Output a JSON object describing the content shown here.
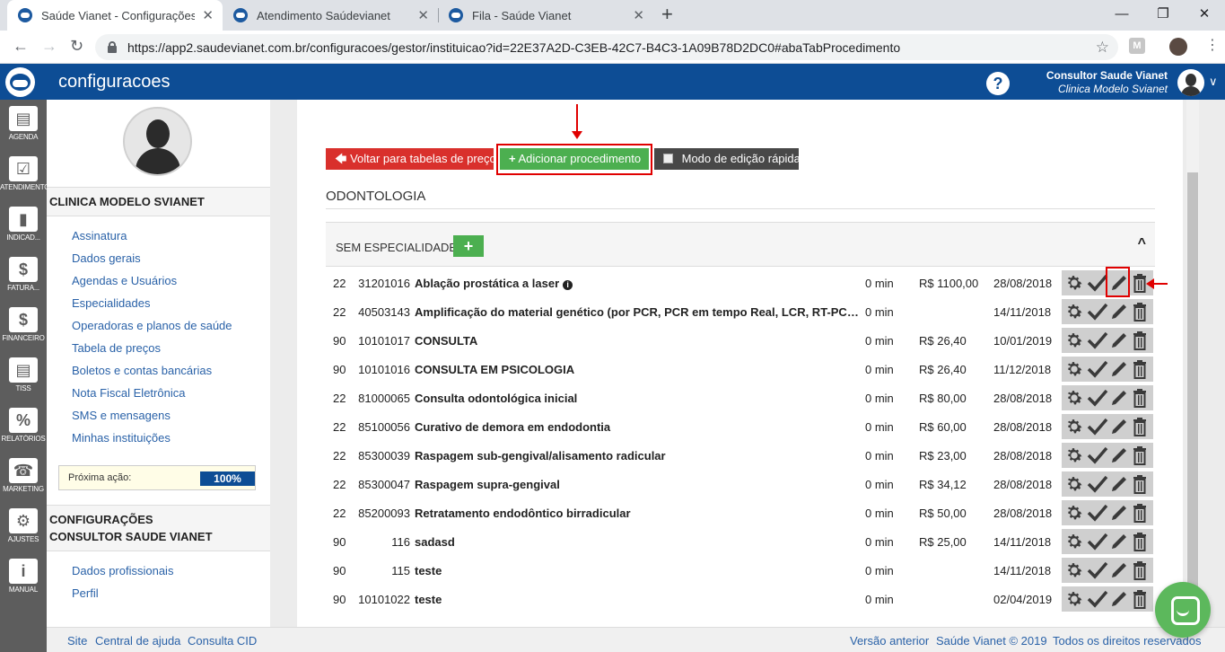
{
  "browser": {
    "tabs": [
      {
        "label": "Saúde Vianet - Configurações",
        "active": true
      },
      {
        "label": "Atendimento Saúdevianet",
        "active": false
      },
      {
        "label": "Fila - Saúde Vianet",
        "active": false
      }
    ],
    "url": "https://app2.saudevianet.com.br/configuracoes/gestor/instituicao?id=22E37A2D-C3EB-42C7-B4C3-1A09B78D2DC0#abaTabProcedimento",
    "new_tab": "+",
    "close_glyph": "✕",
    "win": {
      "minimize": "—",
      "maximize": "❐",
      "close": "✕"
    },
    "ext_letter": "M"
  },
  "header": {
    "title": "configuracoes",
    "help": "?",
    "user_name": "Consultor Saude Vianet",
    "user_clinic": "Clinica Modelo Svianet",
    "brand_color": "#0d4d95"
  },
  "rail": [
    {
      "label": "AGENDA",
      "icon": "agenda-icon",
      "glyph": "▤"
    },
    {
      "label": "ATENDIMENTO",
      "icon": "folder-check-icon",
      "glyph": "☑"
    },
    {
      "label": "INDICAD...",
      "icon": "bar-chart-icon",
      "glyph": "▮"
    },
    {
      "label": "FATURA...",
      "icon": "dollar-doc-icon",
      "glyph": "$"
    },
    {
      "label": "FINANCEIRO",
      "icon": "dollar-doc-icon",
      "glyph": "$"
    },
    {
      "label": "TISS",
      "icon": "book-icon",
      "glyph": "▤"
    },
    {
      "label": "RELATÓRIOS",
      "icon": "percent-doc-icon",
      "glyph": "%"
    },
    {
      "label": "MARKETING",
      "icon": "phone-icon",
      "glyph": "☎"
    },
    {
      "label": "AJUSTES",
      "icon": "gears-icon",
      "glyph": "⚙"
    },
    {
      "label": "MANUAL",
      "icon": "manual-icon",
      "glyph": "i"
    }
  ],
  "sidebar": {
    "clinic_title": "CLINICA MODELO SVIANET",
    "links": [
      "Assinatura",
      "Dados gerais",
      "Agendas e Usuários",
      "Especialidades",
      "Operadoras e planos de saúde",
      "Tabela de preços",
      "Boletos e contas bancárias",
      "Nota Fiscal Eletrônica",
      "SMS e mensagens",
      "Minhas instituições"
    ],
    "next_action_label": "Próxima ação:",
    "progress_percent": 100,
    "progress_text": "100%",
    "config_title_1": "CONFIGURAÇÕES",
    "config_title_2": "CONSULTOR SAUDE VIANET",
    "config_links": [
      "Dados profissionais",
      "Perfil"
    ]
  },
  "toolbar": {
    "back_label": "Voltar para tabelas de preços",
    "add_label": "Adicionar procedimento",
    "quick_edit_label": "Modo de edição rápida"
  },
  "section": {
    "title": "ODONTOLOGIA",
    "group_title": "SEM ESPECIALIDADE",
    "group_add": "+",
    "group_chevron": "^"
  },
  "procedures": [
    {
      "tab": "22",
      "code": "31201016",
      "name": "Ablação prostática a laser",
      "info": true,
      "time": "0 min",
      "price": "R$ 1100,00",
      "date": "28/08/2018"
    },
    {
      "tab": "22",
      "code": "40503143",
      "name": "Amplificação do material genético (por PCR, PCR em tempo Real, LCR, RT-PCR...",
      "info": false,
      "time": "0 min",
      "price": "",
      "date": "14/11/2018"
    },
    {
      "tab": "90",
      "code": "10101017",
      "name": "CONSULTA",
      "info": false,
      "time": "0 min",
      "price": "R$ 26,40",
      "date": "10/01/2019"
    },
    {
      "tab": "90",
      "code": "10101016",
      "name": "CONSULTA EM PSICOLOGIA",
      "info": false,
      "time": "0 min",
      "price": "R$ 26,40",
      "date": "11/12/2018"
    },
    {
      "tab": "22",
      "code": "81000065",
      "name": "Consulta odontológica inicial",
      "info": false,
      "time": "0 min",
      "price": "R$ 80,00",
      "date": "28/08/2018"
    },
    {
      "tab": "22",
      "code": "85100056",
      "name": "Curativo de demora em endodontia",
      "info": false,
      "time": "0 min",
      "price": "R$ 60,00",
      "date": "28/08/2018"
    },
    {
      "tab": "22",
      "code": "85300039",
      "name": "Raspagem sub-gengival/alisamento radicular",
      "info": false,
      "time": "0 min",
      "price": "R$ 23,00",
      "date": "28/08/2018"
    },
    {
      "tab": "22",
      "code": "85300047",
      "name": "Raspagem supra-gengival",
      "info": false,
      "time": "0 min",
      "price": "R$ 34,12",
      "date": "28/08/2018"
    },
    {
      "tab": "22",
      "code": "85200093",
      "name": "Retratamento endodôntico birradicular",
      "info": false,
      "time": "0 min",
      "price": "R$ 50,00",
      "date": "28/08/2018"
    },
    {
      "tab": "90",
      "code": "116",
      "name": "sadasd",
      "info": false,
      "time": "0 min",
      "price": "R$ 25,00",
      "date": "14/11/2018"
    },
    {
      "tab": "90",
      "code": "115",
      "name": "teste",
      "info": false,
      "time": "0 min",
      "price": "",
      "date": "14/11/2018"
    },
    {
      "tab": "90",
      "code": "10101022",
      "name": "teste",
      "info": false,
      "time": "0 min",
      "price": "",
      "date": "02/04/2019"
    }
  ],
  "footer": {
    "site": "Site",
    "help_center": "Central de ajuda",
    "cid": "Consulta CID",
    "previous_version": "Versão anterior",
    "copyright": "Saúde Vianet © 2019",
    "rights": "Todos os direitos reservados"
  }
}
